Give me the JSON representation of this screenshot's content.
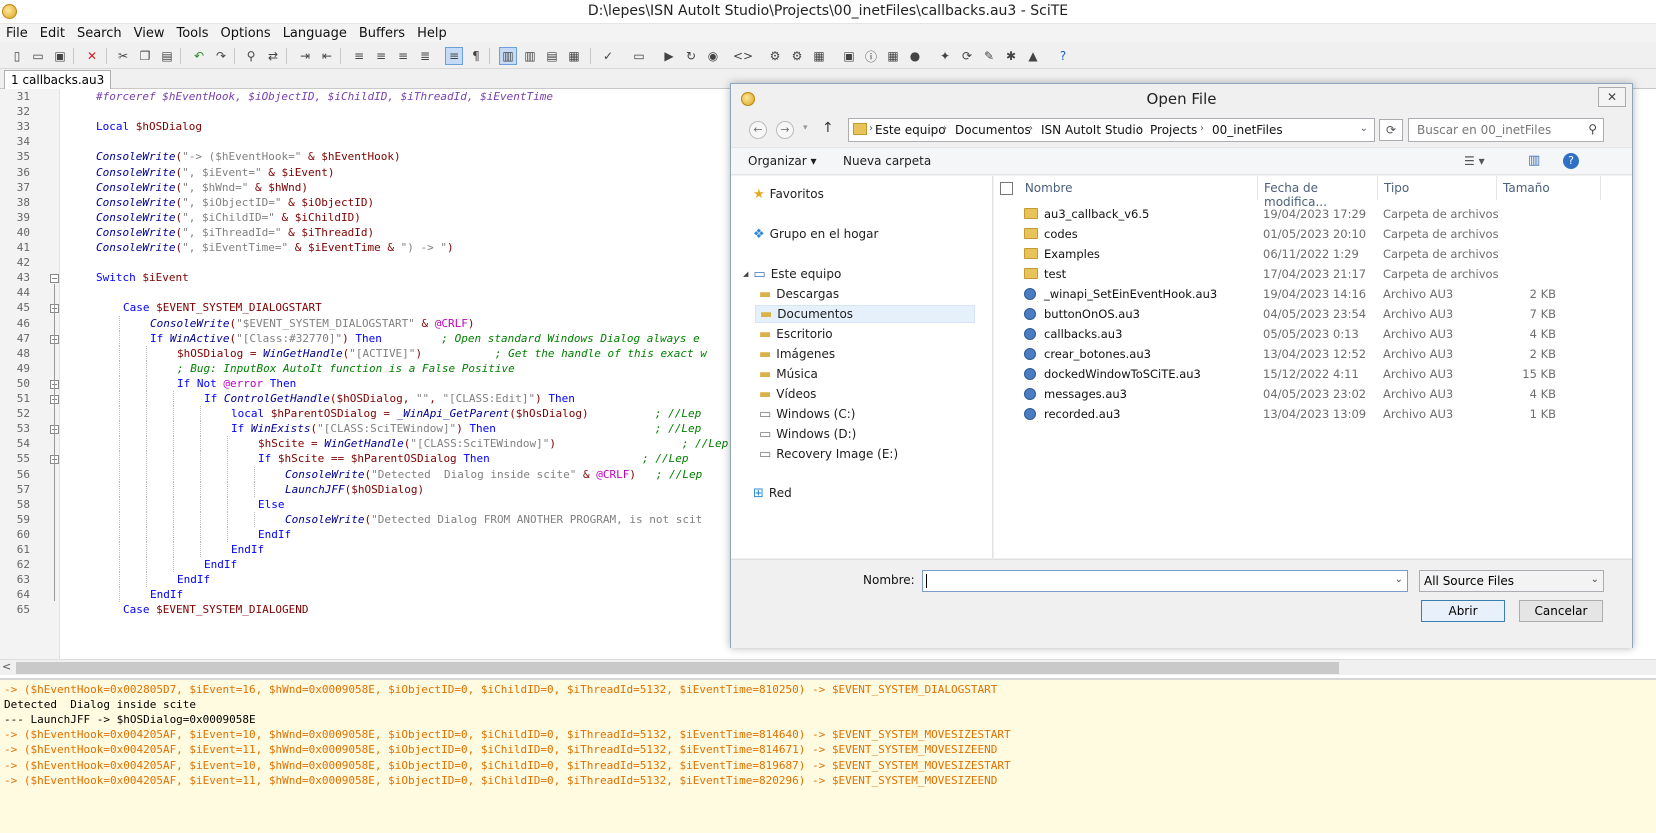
{
  "window": {
    "title": "D:\\lepes\\ISN AutoIt Studio\\Projects\\00_inetFiles\\callbacks.au3 - SciTE"
  },
  "menu": [
    "File",
    "Edit",
    "Search",
    "View",
    "Tools",
    "Options",
    "Language",
    "Buffers",
    "Help"
  ],
  "tabs": [
    {
      "label": "1 callbacks.au3"
    }
  ],
  "colors": {
    "comment": "#7a3fb0",
    "keyword": "#0000ff",
    "variable": "#7f0000",
    "string": "#808080",
    "function": "#000090",
    "green_comment": "#008000",
    "macro": "#c000c0",
    "output_orange": "#e07000",
    "output_bg": "#fffbe0",
    "selection": "#c5dbf5"
  },
  "editor": {
    "lines": [
      {
        "n": "31",
        "indent": 1,
        "tokens": [
          {
            "t": "#forceref $hEventHook, $iObjectID, $iChildID, $iThreadId, $iEventTime",
            "c": "comment"
          }
        ]
      },
      {
        "n": "32",
        "indent": 1,
        "tokens": []
      },
      {
        "n": "33",
        "indent": 1,
        "tokens": [
          {
            "t": "Local ",
            "c": "keyword"
          },
          {
            "t": "$hOSDialog",
            "c": "variable"
          }
        ]
      },
      {
        "n": "34",
        "indent": 1,
        "tokens": []
      },
      {
        "n": "35",
        "indent": 1,
        "tokens": [
          {
            "t": "ConsoleWrite",
            "c": "function"
          },
          {
            "t": "(",
            "c": "variable"
          },
          {
            "t": "\"-> ($hEventHook=\"",
            "c": "string"
          },
          {
            "t": " & $hEventHook)",
            "c": "variable"
          }
        ]
      },
      {
        "n": "36",
        "indent": 1,
        "tokens": [
          {
            "t": "ConsoleWrite",
            "c": "function"
          },
          {
            "t": "(",
            "c": "variable"
          },
          {
            "t": "\", $iEvent=\"",
            "c": "string"
          },
          {
            "t": " & $iEvent)",
            "c": "variable"
          }
        ]
      },
      {
        "n": "37",
        "indent": 1,
        "tokens": [
          {
            "t": "ConsoleWrite",
            "c": "function"
          },
          {
            "t": "(",
            "c": "variable"
          },
          {
            "t": "\", $hWnd=\"",
            "c": "string"
          },
          {
            "t": " & $hWnd)",
            "c": "variable"
          }
        ]
      },
      {
        "n": "38",
        "indent": 1,
        "tokens": [
          {
            "t": "ConsoleWrite",
            "c": "function"
          },
          {
            "t": "(",
            "c": "variable"
          },
          {
            "t": "\", $iObjectID=\"",
            "c": "string"
          },
          {
            "t": " & $iObjectID)",
            "c": "variable"
          }
        ]
      },
      {
        "n": "39",
        "indent": 1,
        "tokens": [
          {
            "t": "ConsoleWrite",
            "c": "function"
          },
          {
            "t": "(",
            "c": "variable"
          },
          {
            "t": "\", $iChildID=\"",
            "c": "string"
          },
          {
            "t": " & $iChildID)",
            "c": "variable"
          }
        ]
      },
      {
        "n": "40",
        "indent": 1,
        "tokens": [
          {
            "t": "ConsoleWrite",
            "c": "function"
          },
          {
            "t": "(",
            "c": "variable"
          },
          {
            "t": "\", $iThreadId=\"",
            "c": "string"
          },
          {
            "t": " & $iThreadId)",
            "c": "variable"
          }
        ]
      },
      {
        "n": "41",
        "indent": 1,
        "tokens": [
          {
            "t": "ConsoleWrite",
            "c": "function"
          },
          {
            "t": "(",
            "c": "variable"
          },
          {
            "t": "\", $iEventTime=\"",
            "c": "string"
          },
          {
            "t": " & $iEventTime & ",
            "c": "variable"
          },
          {
            "t": "\") -> \"",
            "c": "string"
          },
          {
            "t": ")",
            "c": "variable"
          }
        ]
      },
      {
        "n": "42",
        "indent": 1,
        "tokens": []
      },
      {
        "n": "43",
        "indent": 1,
        "fold": true,
        "tokens": [
          {
            "t": "Switch ",
            "c": "keyword"
          },
          {
            "t": "$iEvent",
            "c": "variable"
          }
        ]
      },
      {
        "n": "44",
        "indent": 1,
        "tokens": []
      },
      {
        "n": "45",
        "indent": 2,
        "fold": true,
        "tokens": [
          {
            "t": "Case ",
            "c": "keyword"
          },
          {
            "t": "$EVENT_SYSTEM_DIALOGSTART",
            "c": "variable"
          }
        ]
      },
      {
        "n": "46",
        "indent": 3,
        "tokens": [
          {
            "t": "ConsoleWrite",
            "c": "function"
          },
          {
            "t": "(",
            "c": "variable"
          },
          {
            "t": "\"$EVENT_SYSTEM_DIALOGSTART\"",
            "c": "string"
          },
          {
            "t": " & ",
            "c": "variable"
          },
          {
            "t": "@CRLF",
            "c": "macro"
          },
          {
            "t": ")",
            "c": "variable"
          }
        ]
      },
      {
        "n": "47",
        "indent": 3,
        "fold": true,
        "tokens": [
          {
            "t": "If ",
            "c": "keyword"
          },
          {
            "t": "WinActive",
            "c": "function"
          },
          {
            "t": "(",
            "c": "variable"
          },
          {
            "t": "\"[Class:#32770]\"",
            "c": "string"
          },
          {
            "t": ") ",
            "c": "variable"
          },
          {
            "t": "Then",
            "c": "keyword"
          },
          {
            "t": "         ; Open standard Windows Dialog always e",
            "c": "green_comment"
          }
        ]
      },
      {
        "n": "48",
        "indent": 4,
        "tokens": [
          {
            "t": "$hOSDialog = ",
            "c": "variable"
          },
          {
            "t": "WinGetHandle",
            "c": "function"
          },
          {
            "t": "(",
            "c": "variable"
          },
          {
            "t": "\"[ACTIVE]\"",
            "c": "string"
          },
          {
            "t": ")",
            "c": "variable"
          },
          {
            "t": "           ; Get the handle of this exact w",
            "c": "green_comment"
          }
        ]
      },
      {
        "n": "49",
        "indent": 4,
        "tokens": [
          {
            "t": "; Bug: InputBox AutoIt function is a False Positive",
            "c": "green_comment"
          }
        ]
      },
      {
        "n": "50",
        "indent": 4,
        "fold": true,
        "tokens": [
          {
            "t": "If Not ",
            "c": "keyword"
          },
          {
            "t": "@error",
            "c": "macro"
          },
          {
            "t": " Then",
            "c": "keyword"
          }
        ]
      },
      {
        "n": "51",
        "indent": 5,
        "fold": true,
        "tokens": [
          {
            "t": "If ",
            "c": "keyword"
          },
          {
            "t": "ControlGetHandle",
            "c": "function"
          },
          {
            "t": "($hOSDialog, ",
            "c": "variable"
          },
          {
            "t": "\"\"",
            "c": "string"
          },
          {
            "t": ", ",
            "c": "variable"
          },
          {
            "t": "\"[CLASS:Edit]\"",
            "c": "string"
          },
          {
            "t": ") ",
            "c": "variable"
          },
          {
            "t": "Then",
            "c": "keyword"
          }
        ]
      },
      {
        "n": "52",
        "indent": 6,
        "tokens": [
          {
            "t": "local ",
            "c": "keyword"
          },
          {
            "t": "$hParentOSDialog = ",
            "c": "variable"
          },
          {
            "t": "_WinApi_GetParent",
            "c": "function"
          },
          {
            "t": "($hOsDialog)",
            "c": "variable"
          },
          {
            "t": "          ; //Lep",
            "c": "green_comment"
          }
        ]
      },
      {
        "n": "53",
        "indent": 6,
        "fold": true,
        "tokens": [
          {
            "t": "If ",
            "c": "keyword"
          },
          {
            "t": "WinExists",
            "c": "function"
          },
          {
            "t": "(",
            "c": "variable"
          },
          {
            "t": "\"[CLASS:SciTEWindow]\"",
            "c": "string"
          },
          {
            "t": ") ",
            "c": "variable"
          },
          {
            "t": "Then",
            "c": "keyword"
          },
          {
            "t": "                        ; //Lep",
            "c": "green_comment"
          }
        ]
      },
      {
        "n": "54",
        "indent": 7,
        "tokens": [
          {
            "t": "$hScite = ",
            "c": "variable"
          },
          {
            "t": "WinGetHandle",
            "c": "function"
          },
          {
            "t": "(",
            "c": "variable"
          },
          {
            "t": "\"[CLASS:SciTEWindow]\"",
            "c": "string"
          },
          {
            "t": ")",
            "c": "variable"
          },
          {
            "t": "                   ; //Lep",
            "c": "green_comment"
          }
        ]
      },
      {
        "n": "55",
        "indent": 7,
        "fold": true,
        "tokens": [
          {
            "t": "If ",
            "c": "keyword"
          },
          {
            "t": "$hScite == $hParentOSDialog ",
            "c": "variable"
          },
          {
            "t": "Then",
            "c": "keyword"
          },
          {
            "t": "                       ; //Lep",
            "c": "green_comment"
          }
        ]
      },
      {
        "n": "56",
        "indent": 8,
        "tokens": [
          {
            "t": "ConsoleWrite",
            "c": "function"
          },
          {
            "t": "(",
            "c": "variable"
          },
          {
            "t": "\"Detected  Dialog inside scite\"",
            "c": "string"
          },
          {
            "t": " & ",
            "c": "variable"
          },
          {
            "t": "@CRLF",
            "c": "macro"
          },
          {
            "t": ")",
            "c": "variable"
          },
          {
            "t": "   ; //Lep",
            "c": "green_comment"
          }
        ]
      },
      {
        "n": "57",
        "indent": 8,
        "tokens": [
          {
            "t": "LaunchJFF",
            "c": "function"
          },
          {
            "t": "($hOSDialog)",
            "c": "variable"
          }
        ]
      },
      {
        "n": "58",
        "indent": 7,
        "tokens": [
          {
            "t": "Else",
            "c": "keyword"
          }
        ]
      },
      {
        "n": "59",
        "indent": 8,
        "tokens": [
          {
            "t": "ConsoleWrite",
            "c": "function"
          },
          {
            "t": "(",
            "c": "variable"
          },
          {
            "t": "\"Detected Dialog FROM ANOTHER PROGRAM, is not scit",
            "c": "string"
          }
        ]
      },
      {
        "n": "60",
        "indent": 7,
        "tokens": [
          {
            "t": "EndIf",
            "c": "keyword"
          }
        ]
      },
      {
        "n": "61",
        "indent": 6,
        "tokens": [
          {
            "t": "EndIf",
            "c": "keyword"
          }
        ]
      },
      {
        "n": "62",
        "indent": 5,
        "tokens": [
          {
            "t": "EndIf",
            "c": "keyword"
          }
        ]
      },
      {
        "n": "63",
        "indent": 4,
        "tokens": [
          {
            "t": "EndIf",
            "c": "keyword"
          }
        ]
      },
      {
        "n": "64",
        "indent": 3,
        "tokens": [
          {
            "t": "EndIf",
            "c": "keyword"
          }
        ]
      },
      {
        "n": "65",
        "indent": 2,
        "tokens": [
          {
            "t": "Case ",
            "c": "keyword"
          },
          {
            "t": "$EVENT_SYSTEM_DIALOGEND",
            "c": "variable"
          }
        ]
      }
    ]
  },
  "output": {
    "lines": [
      {
        "t": "-> ($hEventHook=0x002805D7, $iEvent=16, $hWnd=0x0009058E, $iObjectID=0, $iChildID=0, $iThreadId=5132, $iEventTime=810250) -> $EVENT_SYSTEM_DIALOGSTART",
        "c": "output_orange"
      },
      {
        "t": "Detected  Dialog inside scite",
        "c": "black"
      },
      {
        "t": "--- LaunchJFF -> $hOSDialog=0x0009058E",
        "c": "black"
      },
      {
        "t": "-> ($hEventHook=0x004205AF, $iEvent=10, $hWnd=0x0009058E, $iObjectID=0, $iChildID=0, $iThreadId=5132, $iEventTime=814640) -> $EVENT_SYSTEM_MOVESIZESTART",
        "c": "output_orange"
      },
      {
        "t": "-> ($hEventHook=0x004205AF, $iEvent=11, $hWnd=0x0009058E, $iObjectID=0, $iChildID=0, $iThreadId=5132, $iEventTime=814671) -> $EVENT_SYSTEM_MOVESIZEEND",
        "c": "output_orange"
      },
      {
        "t": "-> ($hEventHook=0x004205AF, $iEvent=10, $hWnd=0x0009058E, $iObjectID=0, $iChildID=0, $iThreadId=5132, $iEventTime=819687) -> $EVENT_SYSTEM_MOVESIZESTART",
        "c": "output_orange"
      },
      {
        "t": "-> ($hEventHook=0x004205AF, $iEvent=11, $hWnd=0x0009058E, $iObjectID=0, $iChildID=0, $iThreadId=5132, $iEventTime=820296) -> $EVENT_SYSTEM_MOVESIZEEND",
        "c": "output_orange"
      }
    ]
  },
  "dialog": {
    "title": "Open File",
    "close_glyph": "✕",
    "address": [
      "Este equipo",
      "Documentos",
      "ISN AutoIt Studio",
      "Projects",
      "00_inetFiles"
    ],
    "search_placeholder": "Buscar en 00_inetFiles",
    "organize_label": "Organizar ▾",
    "new_folder_label": "Nueva carpeta",
    "nav": [
      {
        "label": "Favoritos",
        "icon": "star-icon",
        "level": 0,
        "selected": false
      },
      {
        "label": "Grupo en el hogar",
        "icon": "homegroup-icon",
        "level": 0,
        "selected": false
      },
      {
        "label": "Este equipo",
        "icon": "computer-icon",
        "level": 0,
        "selected": false
      },
      {
        "label": "Descargas",
        "icon": "folder-icon",
        "level": 1,
        "selected": false
      },
      {
        "label": "Documentos",
        "icon": "folder-icon",
        "level": 1,
        "selected": true
      },
      {
        "label": "Escritorio",
        "icon": "folder-icon",
        "level": 1,
        "selected": false
      },
      {
        "label": "Imágenes",
        "icon": "folder-icon",
        "level": 1,
        "selected": false
      },
      {
        "label": "Música",
        "icon": "folder-icon",
        "level": 1,
        "selected": false
      },
      {
        "label": "Vídeos",
        "icon": "folder-icon",
        "level": 1,
        "selected": false
      },
      {
        "label": "Windows (C:)",
        "icon": "drive-icon",
        "level": 1,
        "selected": false
      },
      {
        "label": "Windows (D:)",
        "icon": "drive-icon",
        "level": 1,
        "selected": false
      },
      {
        "label": "Recovery Image (E:)",
        "icon": "drive-icon",
        "level": 1,
        "selected": false
      },
      {
        "label": "Red",
        "icon": "network-icon",
        "level": 0,
        "selected": false
      }
    ],
    "columns": [
      "Nombre",
      "Fecha de modifica...",
      "Tipo",
      "Tamaño"
    ],
    "files": [
      {
        "name": "au3_callback_v6.5",
        "date": "19/04/2023 17:29",
        "type": "Carpeta de archivos",
        "size": "",
        "kind": "folder"
      },
      {
        "name": "codes",
        "date": "01/05/2023 20:10",
        "type": "Carpeta de archivos",
        "size": "",
        "kind": "folder"
      },
      {
        "name": "Examples",
        "date": "06/11/2022 1:29",
        "type": "Carpeta de archivos",
        "size": "",
        "kind": "folder"
      },
      {
        "name": "test",
        "date": "17/04/2023 21:17",
        "type": "Carpeta de archivos",
        "size": "",
        "kind": "folder"
      },
      {
        "name": "_winapi_SetEinEventHook.au3",
        "date": "19/04/2023 14:16",
        "type": "Archivo AU3",
        "size": "2 KB",
        "kind": "au3"
      },
      {
        "name": "buttonOnOS.au3",
        "date": "04/05/2023 23:54",
        "type": "Archivo AU3",
        "size": "7 KB",
        "kind": "au3"
      },
      {
        "name": "callbacks.au3",
        "date": "05/05/2023 0:13",
        "type": "Archivo AU3",
        "size": "4 KB",
        "kind": "au3"
      },
      {
        "name": "crear_botones.au3",
        "date": "13/04/2023 12:52",
        "type": "Archivo AU3",
        "size": "2 KB",
        "kind": "au3"
      },
      {
        "name": "dockedWindowToSCiTE.au3",
        "date": "15/12/2022 4:11",
        "type": "Archivo AU3",
        "size": "15 KB",
        "kind": "au3"
      },
      {
        "name": "messages.au3",
        "date": "04/05/2023 23:02",
        "type": "Archivo AU3",
        "size": "4 KB",
        "kind": "au3"
      },
      {
        "name": "recorded.au3",
        "date": "13/04/2023 13:09",
        "type": "Archivo AU3",
        "size": "1 KB",
        "kind": "au3"
      }
    ],
    "filename_label": "Nombre:",
    "filename_value": "",
    "filetype_value": "All Source Files",
    "open_button": "Abrir",
    "cancel_button": "Cancelar"
  }
}
